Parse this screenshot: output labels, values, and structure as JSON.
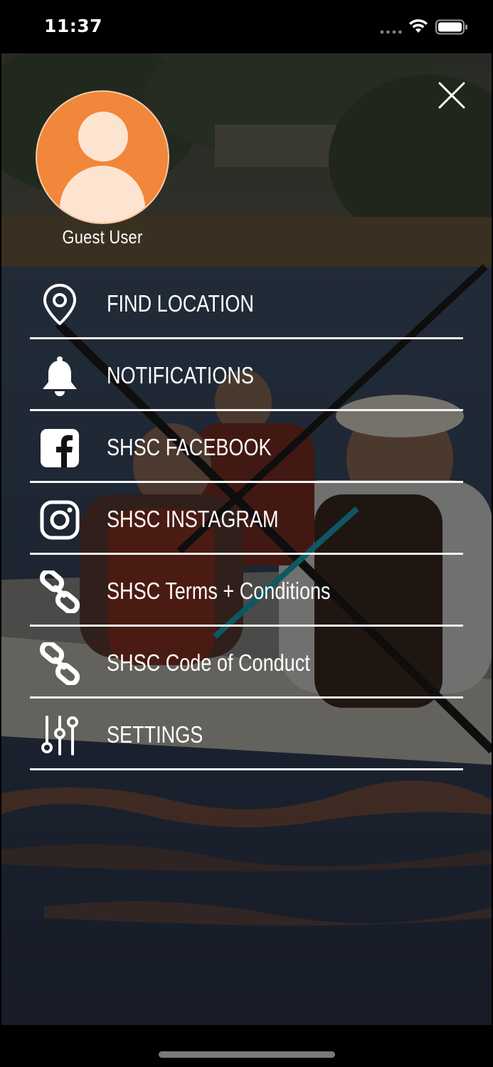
{
  "status_bar": {
    "time": "11:37"
  },
  "user": {
    "name": "Guest User",
    "avatar_color": "#f0873a"
  },
  "menu": {
    "items": [
      {
        "label": "FIND LOCATION",
        "icon": "map-pin-icon"
      },
      {
        "label": "NOTIFICATIONS",
        "icon": "bell-icon"
      },
      {
        "label": "SHSC FACEBOOK",
        "icon": "facebook-icon"
      },
      {
        "label": "SHSC INSTAGRAM",
        "icon": "instagram-icon"
      },
      {
        "label": "SHSC Terms + Conditions",
        "icon": "link-icon"
      },
      {
        "label": "SHSC Code of Conduct",
        "icon": "link-icon"
      },
      {
        "label": "SETTINGS",
        "icon": "sliders-icon"
      }
    ]
  },
  "colors": {
    "divider": "#f3f3f3",
    "text": "#ffffff",
    "accent": "#f0873a"
  }
}
